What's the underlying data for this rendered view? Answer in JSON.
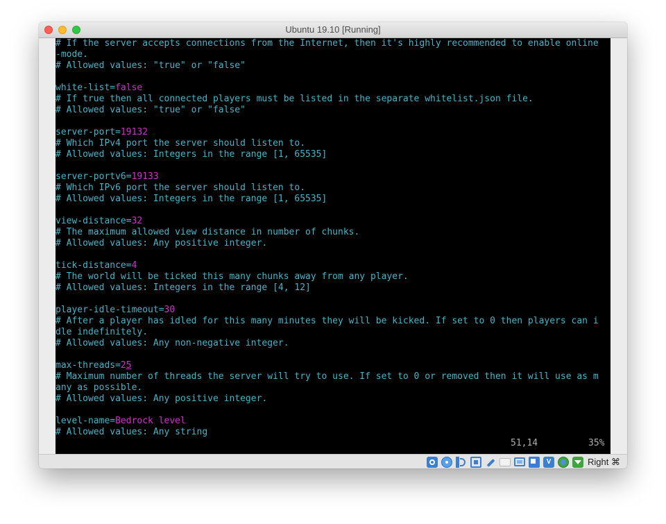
{
  "window": {
    "title": "Ubuntu 19.10 [Running]"
  },
  "terminal": {
    "lines": [
      [
        {
          "t": "# If the server accepts connections from the Internet, then it's highly recommended to enable online",
          "c": "c"
        }
      ],
      [
        {
          "t": "-mode.",
          "c": "c"
        }
      ],
      [
        {
          "t": "# Allowed values: \"true\" or \"false\"",
          "c": "c"
        }
      ],
      [
        {
          "t": "",
          "c": "c"
        }
      ],
      [
        {
          "t": "white-list=",
          "c": "k"
        },
        {
          "t": "false",
          "c": "v"
        }
      ],
      [
        {
          "t": "# If true then all connected players must be listed in the separate whitelist.json file.",
          "c": "c"
        }
      ],
      [
        {
          "t": "# Allowed values: \"true\" or \"false\"",
          "c": "c"
        }
      ],
      [
        {
          "t": "",
          "c": "c"
        }
      ],
      [
        {
          "t": "server-port=",
          "c": "k"
        },
        {
          "t": "19132",
          "c": "v"
        }
      ],
      [
        {
          "t": "# Which IPv4 port the server should listen to.",
          "c": "c"
        }
      ],
      [
        {
          "t": "# Allowed values: Integers in the range [1, 65535]",
          "c": "c"
        }
      ],
      [
        {
          "t": "",
          "c": "c"
        }
      ],
      [
        {
          "t": "server-portv6=",
          "c": "k"
        },
        {
          "t": "19133",
          "c": "v"
        }
      ],
      [
        {
          "t": "# Which IPv6 port the server should listen to.",
          "c": "c"
        }
      ],
      [
        {
          "t": "# Allowed values: Integers in the range [1, 65535]",
          "c": "c"
        }
      ],
      [
        {
          "t": "",
          "c": "c"
        }
      ],
      [
        {
          "t": "view-distance=",
          "c": "k"
        },
        {
          "t": "32",
          "c": "v"
        }
      ],
      [
        {
          "t": "# The maximum allowed view distance in number of chunks.",
          "c": "c"
        }
      ],
      [
        {
          "t": "# Allowed values: Any positive integer.",
          "c": "c"
        }
      ],
      [
        {
          "t": "",
          "c": "c"
        }
      ],
      [
        {
          "t": "tick-distance=",
          "c": "k"
        },
        {
          "t": "4",
          "c": "v"
        }
      ],
      [
        {
          "t": "# The world will be ticked this many chunks away from any player.",
          "c": "c"
        }
      ],
      [
        {
          "t": "# Allowed values: Integers in the range [4, 12]",
          "c": "c"
        }
      ],
      [
        {
          "t": "",
          "c": "c"
        }
      ],
      [
        {
          "t": "player-idle-timeout=",
          "c": "k"
        },
        {
          "t": "30",
          "c": "v"
        }
      ],
      [
        {
          "t": "# After a player has idled for this many minutes they will be kicked. If set to 0 then players can i",
          "c": "c"
        }
      ],
      [
        {
          "t": "dle indefinitely.",
          "c": "c"
        }
      ],
      [
        {
          "t": "# Allowed values: Any non-negative integer.",
          "c": "c"
        }
      ],
      [
        {
          "t": "",
          "c": "c"
        }
      ],
      [
        {
          "t": "max-threads=",
          "c": "k"
        },
        {
          "t": "2",
          "c": "v"
        },
        {
          "t": "5",
          "c": "vcur"
        }
      ],
      [
        {
          "t": "# Maximum number of threads the server will try to use. If set to 0 or removed then it will use as m",
          "c": "c"
        }
      ],
      [
        {
          "t": "any as possible.",
          "c": "c"
        }
      ],
      [
        {
          "t": "# Allowed values: Any positive integer.",
          "c": "c"
        }
      ],
      [
        {
          "t": "",
          "c": "c"
        }
      ],
      [
        {
          "t": "level-name=",
          "c": "k"
        },
        {
          "t": "Bedrock level",
          "c": "v"
        }
      ],
      [
        {
          "t": "# Allowed values: Any string",
          "c": "c"
        }
      ]
    ],
    "cursor_position": "51,14",
    "scroll_percent": "35%"
  },
  "statusbar": {
    "icons": [
      "hard-disk-icon",
      "optical-drive-icon",
      "audio-icon",
      "network-icon",
      "usb-icon",
      "shared-folder-icon",
      "display-icon",
      "video-capture-icon",
      "vt-x-icon",
      "globe-icon",
      "download-arrow-icon"
    ],
    "host_key": "Right ⌘"
  },
  "colors": {
    "comment": "#46b4c8",
    "key": "#46b4c8",
    "value": "#d22fcc",
    "background": "#000000"
  }
}
